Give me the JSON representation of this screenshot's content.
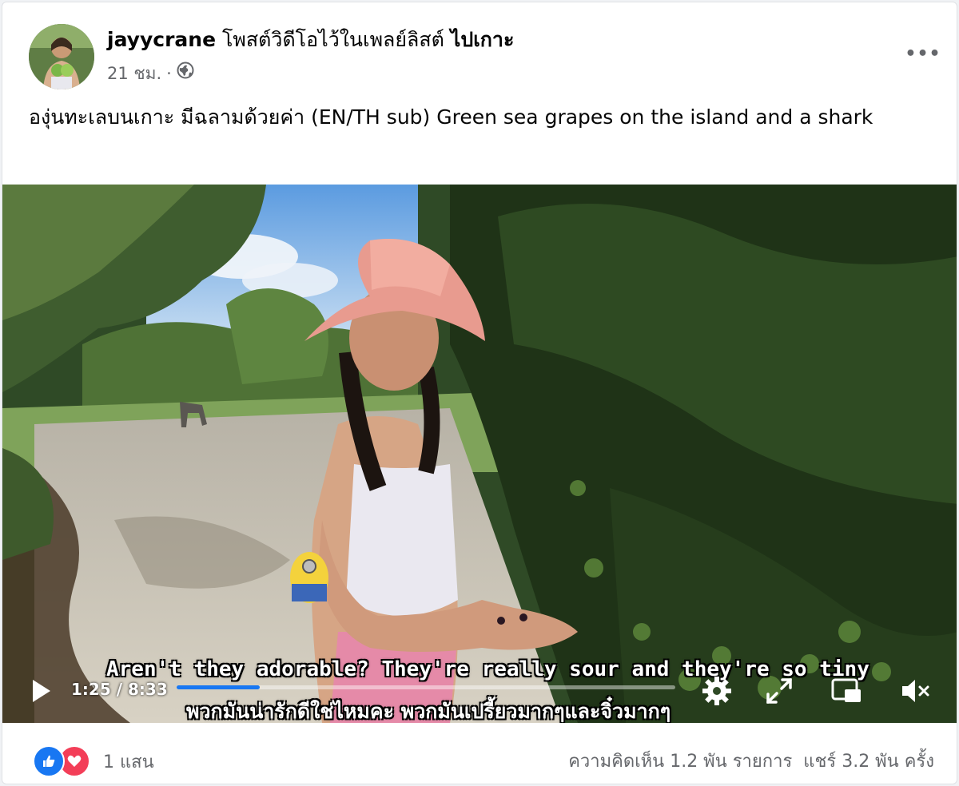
{
  "post": {
    "author": "jayycrane",
    "action": "โพสต์วิดีโอไว้ในเพลย์ลิสต์",
    "playlist": "ไปเกาะ",
    "time": "21 ชม.",
    "separator": "·",
    "audience_icon": "globe-icon",
    "more_label": "•••",
    "caption": "องุ่นทะเลบนเกาะ มีฉลามด้วยค่า (EN/TH sub) Green sea grapes on the island and a shark"
  },
  "video": {
    "subtitle_en": "Aren't they adorable? They're really sour and they're so tiny",
    "subtitle_th": "พวกมันน่ารักดีใช่ไหมคะ พวกมันเปรี้ยวมากๆและจิ๋วมากๆ",
    "current_time": "1:25",
    "time_separator": "/",
    "duration": "8:33",
    "progress_fraction": 0.166,
    "accent": "#1877f2",
    "icons": [
      "play-icon",
      "gear-icon",
      "expand-icon",
      "pip-icon",
      "mute-icon"
    ]
  },
  "footer": {
    "reaction_count": "1 แสน",
    "comments": "ความคิดเห็น 1.2 พัน รายการ",
    "shares": "แชร์ 3.2 พัน ครั้ง"
  }
}
